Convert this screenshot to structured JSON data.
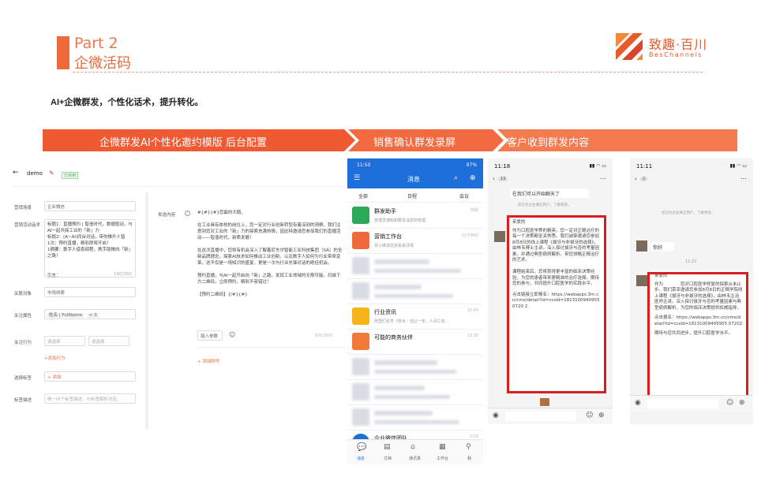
{
  "header": {
    "part": "Part 2",
    "title": "企微活码"
  },
  "logo": {
    "cn": "致趣·百川",
    "en": "BesChannels",
    "brand_color": "#e95a2a"
  },
  "subtitle": "AI+企微群发，个性化话术，提升转化。",
  "banners": [
    "企微群发AI个性化邀约模版 后台配置",
    "销售确认群发录屏",
    "客户收到群发内容"
  ],
  "accent": "#ee6a3a",
  "admin": {
    "back": "demo",
    "badge": "已启用",
    "labels": [
      "营销场景",
      "营销活动话术",
      "关联对象",
      "关注属性",
      "关注行为",
      "选择标签",
      "标签描述",
      "发送内容"
    ],
    "scene_value": "企业微信",
    "script_text": "标题1：直播预约 | 智造时代，数据驱动，与AI一起共探工业的「新」力\n标题2：(A~AI)同台对话，带你推升人智\n1次：预约直播，精彩即将开启！\n1摘要：数字人借喜闻程，携手助推向「新」之路！",
    "script_hint": "引言：",
    "script_count": "190/300",
    "object_value": "市场线索",
    "attr_tag": "姓名 | FullName",
    "attr_more": "+ 3",
    "behavior_a": "请选择",
    "behavior_b": "请选择",
    "add_behavior": "+添加行为",
    "add_tag": "+ 添加",
    "tag_desc_placeholder": "唯一问个标签描述，与标签解析对应。",
    "message": "#{#}{#}您最的大鹅，\n\n在工业具有体核的岗位上，您一定对行业创新转型有着深刻的洞察。我们注意到您对工业的「新」力的探索充满热情，因此特邀请您参加我们的直播活动——智造时代，新质发展！\n\n在这次直播中，您将有机会深入了解着尼东尔智能工业科技集团（SA）的全新品牌理念，探索AI技术如何推动工业创新，以及数字人如何为行业带来变革。这不仅是一场知识的盛宴，更是一次与行业先锋对话的绝佳机会。\n\n预约直播，与AI一起开启向「新」之路，发现工业领域的无限可能。扫描下方二维码，立即预约，精彩不容错过！\n\n【预约二维码】{/#}{#}",
    "insert_param": "插入参数",
    "counter": "300/300",
    "add_attachment": "+ 添加附件"
  },
  "phone1": {
    "time": "11:50",
    "status": "97%",
    "title": "消息",
    "filters": [
      "全部",
      "日程",
      "会议"
    ],
    "chats": [
      {
        "name": "群发助手",
        "preview": "管理员通知和群发消息的管理",
        "time": "刚刚"
      },
      {
        "name": "营销工作台",
        "preview": "本小牌请您进看看详情",
        "time": "22分钟前"
      },
      {
        "name": "行业资讯",
        "preview": "阿里们名号《李水：但让一年，人间三年…",
        "time": "10:49"
      },
      {
        "name": "可能的商务伙伴",
        "preview": "",
        "time": "10:38"
      },
      {
        "name": "企业微信团队",
        "preview": "",
        "time": "2/29"
      }
    ],
    "tabs": [
      "消息",
      "文档",
      "通讯录",
      "工作台",
      "我"
    ]
  },
  "phone2": {
    "time": "11:18",
    "unread": "13",
    "top_text": "在我们可以开始聊天了",
    "sys_note": "您已为企业微信用户，了解更多。",
    "greeting": "亲爱的",
    "body": "作为口腔医学界的精英，您一定对正畸治疗的每一个决策都至关熟悉。我们诚挚邀请您参加8月8日的线上课程《拔牙与非拔牙的选择》，由林韦博士主讲，深入探讨拔牙与否的考量因素，并通过典型病例解析，带您领略正畸治疗的艺术。\n\n课程结束后，您将获得更丰富的临床决策经验，为您的患者带来更精准的治疗选择。期待您的参与，共同提升口腔医学的实践水平。",
    "link": "点击链接立即报名：https://webapps.3m.cn/cms/detail?id=ccsId=18131009409550720 2"
  },
  "phone3": {
    "time": "11:11",
    "unread": "2",
    "sys_note": "您已为企业微信用户，了解更多。",
    "hello": "你好",
    "stamp": "11:22",
    "greeting": "亲爱的",
    "body": "作为　　　　您对口腔医学修复的探索从未止步。我们荣幸邀请您参加8月8日的正畸学院线上课程《拔牙与非拔牙的选择》，由林韦主治医师主讲。深入探讨拔牙与否的考量因素与典型病例解析，为您的临床决策提供权威指导。",
    "link": "点击报名：https://webapps.3m.cn/cms/detail?id=ccsId=18131009405955 07202",
    "closing": "期待与您共同进步，提升口腔医学水平。"
  }
}
